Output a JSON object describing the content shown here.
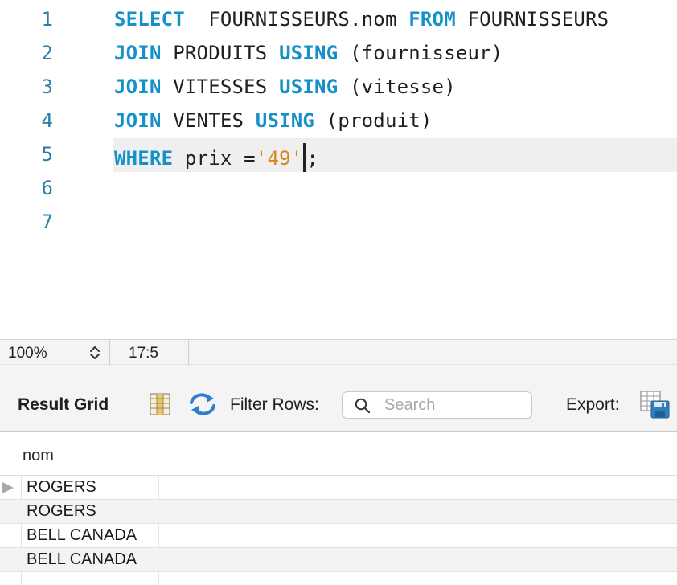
{
  "editor": {
    "line_numbers": [
      "1",
      "2",
      "3",
      "4",
      "5",
      "6",
      "7"
    ],
    "lines": [
      [
        {
          "t": "SELECT",
          "k": "kw"
        },
        {
          "t": "  FOURNISSEURS.nom ",
          "k": ""
        },
        {
          "t": "FROM",
          "k": "kw"
        },
        {
          "t": " FOURNISSEURS",
          "k": ""
        }
      ],
      [
        {
          "t": "JOIN",
          "k": "kw"
        },
        {
          "t": " PRODUITS ",
          "k": ""
        },
        {
          "t": "USING",
          "k": "kw"
        },
        {
          "t": " (fournisseur)",
          "k": ""
        }
      ],
      [
        {
          "t": "JOIN",
          "k": "kw"
        },
        {
          "t": " VITESSES ",
          "k": ""
        },
        {
          "t": "USING",
          "k": "kw"
        },
        {
          "t": " (vitesse)",
          "k": ""
        }
      ],
      [
        {
          "t": "JOIN",
          "k": "kw"
        },
        {
          "t": " VENTES ",
          "k": ""
        },
        {
          "t": "USING",
          "k": "kw"
        },
        {
          "t": " (produit)",
          "k": ""
        }
      ],
      [
        {
          "t": "WHERE",
          "k": "kw"
        },
        {
          "t": " prix =",
          "k": ""
        },
        {
          "t": "'49'",
          "k": "str"
        },
        {
          "t": "",
          "k": "caret"
        },
        {
          "t": ";",
          "k": ""
        }
      ],
      [],
      []
    ],
    "active_line": 5,
    "colors": {
      "keyword": "#1590c8",
      "string": "#d9861c",
      "line_number": "#2b7fa5"
    }
  },
  "statusbar": {
    "zoom": "100%",
    "cursor_position": "17:5"
  },
  "result_toolbar": {
    "result_grid_label": "Result Grid",
    "filter_label": "Filter Rows:",
    "search_placeholder": "Search",
    "search_value": "",
    "export_label": "Export:",
    "icons": [
      "grid-toggle-icon",
      "refresh-icon",
      "search-icon",
      "export-icon"
    ]
  },
  "grid": {
    "columns": [
      "nom"
    ],
    "rows": [
      [
        "ROGERS"
      ],
      [
        "ROGERS"
      ],
      [
        "BELL CANADA"
      ],
      [
        "BELL CANADA"
      ]
    ],
    "selected_row": 0
  }
}
